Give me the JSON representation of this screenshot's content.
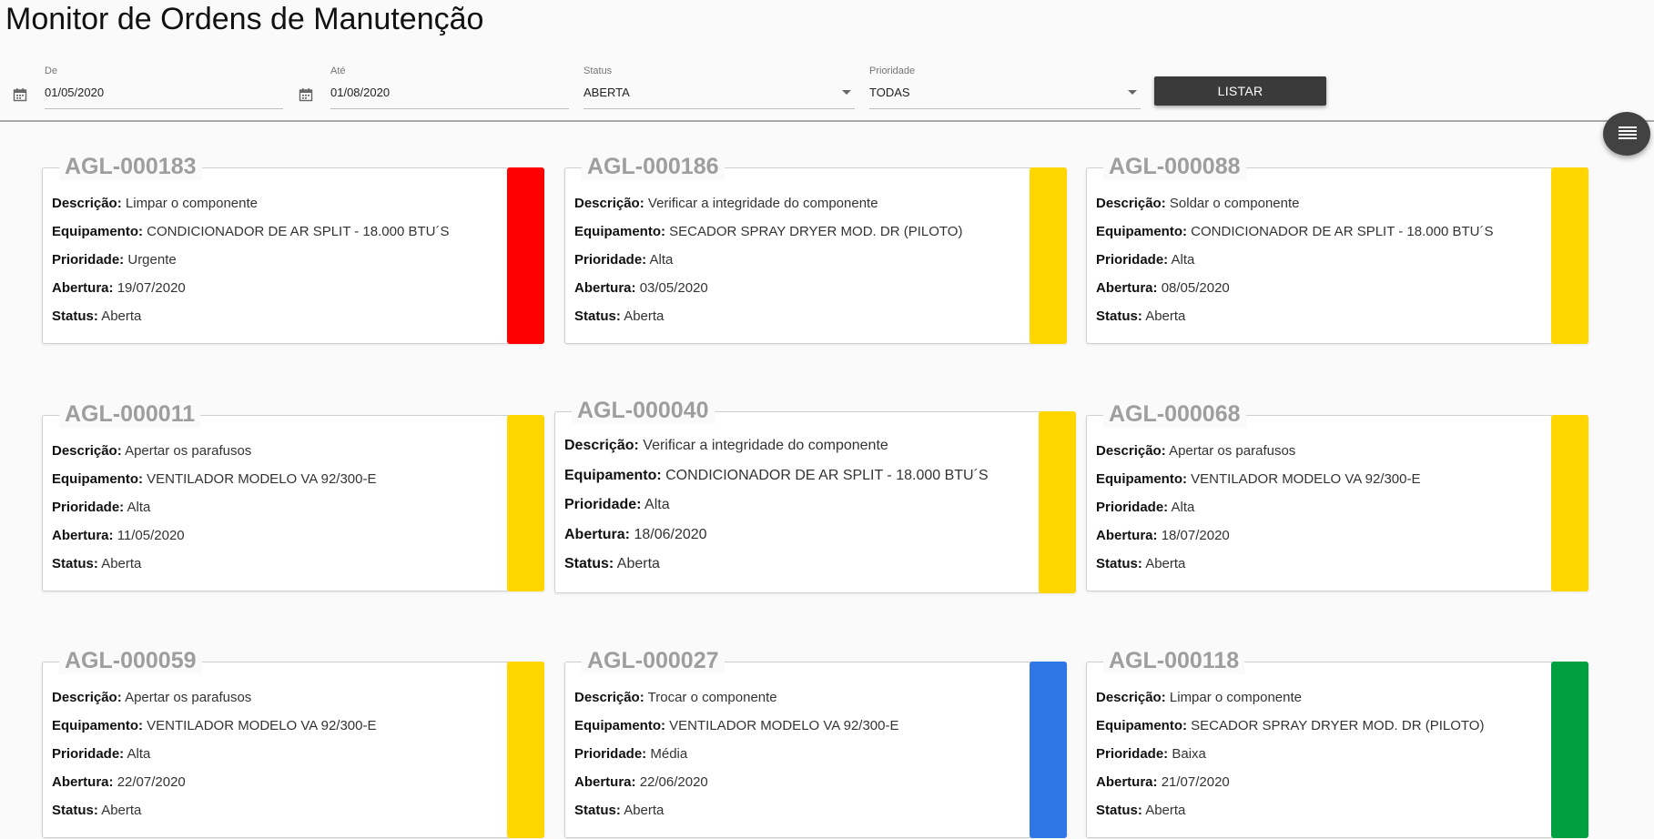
{
  "header": {
    "title": "Monitor de Ordens de Manutenção"
  },
  "filters": {
    "de": {
      "label": "De",
      "value": "01/05/2020",
      "icon": "calendar-icon"
    },
    "ate": {
      "label": "Até",
      "value": "01/08/2020",
      "icon": "calendar-icon"
    },
    "status": {
      "label": "Status",
      "value": "ABERTA"
    },
    "prioridade": {
      "label": "Prioridade",
      "value": "TODAS"
    },
    "listar_label": "LISTAR"
  },
  "fab": {
    "icon": "menu-list-icon"
  },
  "field_labels": {
    "descricao": "Descrição:",
    "equipamento": "Equipamento:",
    "prioridade": "Prioridade:",
    "abertura": "Abertura:",
    "status": "Status:"
  },
  "colors": {
    "urgente": "#ff0000",
    "alta": "#ffd600",
    "media": "#2f77e6",
    "baixa": "#00a040"
  },
  "orders": [
    {
      "id": "AGL-000183",
      "descricao": "Limpar o componente",
      "equipamento": "CONDICIONADOR DE AR SPLIT - 18.000 BTU´S",
      "prioridade": "Urgente",
      "abertura": "19/07/2020",
      "status": "Aberta",
      "color": "#ff0000"
    },
    {
      "id": "AGL-000186",
      "descricao": "Verificar a integridade do componente",
      "equipamento": "SECADOR SPRAY DRYER MOD. DR (PILOTO)",
      "prioridade": "Alta",
      "abertura": "03/05/2020",
      "status": "Aberta",
      "color": "#ffd600"
    },
    {
      "id": "AGL-000088",
      "descricao": "Soldar o componente",
      "equipamento": "CONDICIONADOR DE AR SPLIT - 18.000 BTU´S",
      "prioridade": "Alta",
      "abertura": "08/05/2020",
      "status": "Aberta",
      "color": "#ffd600"
    },
    {
      "id": "AGL-000011",
      "descricao": "Apertar os parafusos",
      "equipamento": "VENTILADOR MODELO VA 92/300-E",
      "prioridade": "Alta",
      "abertura": "11/05/2020",
      "status": "Aberta",
      "color": "#ffd600"
    },
    {
      "id": "AGL-000040",
      "descricao": "Verificar a integridade do componente",
      "equipamento": "CONDICIONADOR DE AR SPLIT - 18.000 BTU´S",
      "prioridade": "Alta",
      "abertura": "18/06/2020",
      "status": "Aberta",
      "color": "#ffd600"
    },
    {
      "id": "AGL-000068",
      "descricao": "Apertar os parafusos",
      "equipamento": "VENTILADOR MODELO VA 92/300-E",
      "prioridade": "Alta",
      "abertura": "18/07/2020",
      "status": "Aberta",
      "color": "#ffd600"
    },
    {
      "id": "AGL-000059",
      "descricao": "Apertar os parafusos",
      "equipamento": "VENTILADOR MODELO VA 92/300-E",
      "prioridade": "Alta",
      "abertura": "22/07/2020",
      "status": "Aberta",
      "color": "#ffd600"
    },
    {
      "id": "AGL-000027",
      "descricao": "Trocar o componente",
      "equipamento": "VENTILADOR MODELO VA 92/300-E",
      "prioridade": "Média",
      "abertura": "22/06/2020",
      "status": "Aberta",
      "color": "#2f77e6"
    },
    {
      "id": "AGL-000118",
      "descricao": "Limpar o componente",
      "equipamento": "SECADOR SPRAY DRYER MOD. DR (PILOTO)",
      "prioridade": "Baixa",
      "abertura": "21/07/2020",
      "status": "Aberta",
      "color": "#00a040"
    }
  ]
}
